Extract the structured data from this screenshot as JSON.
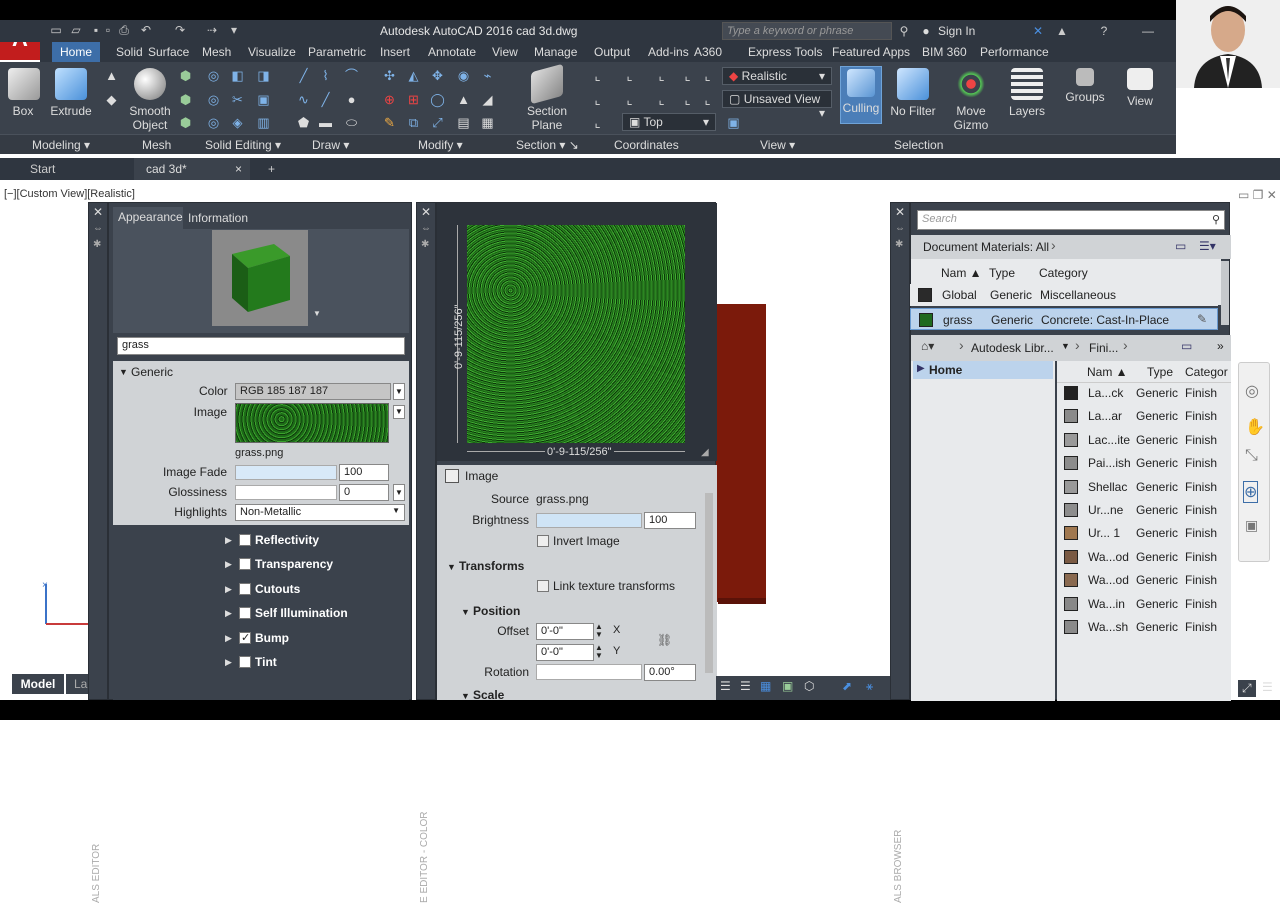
{
  "app": {
    "title": "Autodesk AutoCAD 2016    cad 3d.dwg",
    "search_placeholder": "Type a keyword or phrase",
    "signin": "Sign In",
    "logo": "A"
  },
  "menu_tabs": [
    "Home",
    "Solid",
    "Surface",
    "Mesh",
    "Visualize",
    "Parametric",
    "Insert",
    "Annotate",
    "View",
    "Manage",
    "Output",
    "Add-ins",
    "A360",
    "Express Tools",
    "Featured Apps",
    "BIM 360",
    "Performance"
  ],
  "ribbon": {
    "box": "Box",
    "extrude": "Extrude",
    "smooth_object": "Smooth Object",
    "section_plane": "Section Plane",
    "visual_style": "Realistic",
    "saved_view": "Unsaved View",
    "view_top": "Top",
    "culling": "Culling",
    "no_filter": "No Filter",
    "move_gizmo": "Move Gizmo",
    "layers": "Layers",
    "groups": "Groups",
    "view": "View",
    "panels": {
      "modeling": "Modeling",
      "mesh": "Mesh",
      "solid_editing": "Solid Editing",
      "draw": "Draw",
      "modify": "Modify",
      "section": "Section",
      "coordinates": "Coordinates",
      "view": "View",
      "selection": "Selection"
    }
  },
  "doc_tabs": {
    "start": "Start",
    "cad3d": "cad 3d*"
  },
  "viewport_label": "[−][Custom View][Realistic]",
  "model_tab": "Model",
  "layout_tab": "La",
  "material_editor": {
    "tab_appearance": "Appearance",
    "tab_information": "Information",
    "name": "grass",
    "generic": "Generic",
    "color_label": "Color",
    "color_value": "RGB 185 187 187",
    "image_label": "Image",
    "image_file": "grass.png",
    "image_fade_label": "Image Fade",
    "image_fade_value": "100",
    "glossiness_label": "Glossiness",
    "glossiness_value": "0",
    "highlights_label": "Highlights",
    "highlights_value": "Non-Metallic",
    "sections": [
      "Reflectivity",
      "Transparency",
      "Cutouts",
      "Self Illumination",
      "Bump",
      "Tint"
    ],
    "side_label": "ALS EDITOR"
  },
  "texture_editor": {
    "dim_vertical": "0'-9-115/256\"",
    "dim_horizontal": "0'-9-115/256\"",
    "image_header": "Image",
    "source_label": "Source",
    "source_value": "grass.png",
    "brightness_label": "Brightness",
    "brightness_value": "100",
    "invert_image": "Invert Image",
    "transforms": "Transforms",
    "link_texture": "Link texture transforms",
    "position": "Position",
    "offset_label": "Offset",
    "offset_x": "0'-0\"",
    "offset_y": "0'-0\"",
    "x": "X",
    "y": "Y",
    "rotation_label": "Rotation",
    "rotation_value": "0.00°",
    "scale": "Scale",
    "side_label": "E EDITOR - COLOR"
  },
  "materials_browser": {
    "search_placeholder": "Search",
    "doc_materials": "Document Materials: All",
    "col_name": "Nam",
    "col_type": "Type",
    "col_category": "Category",
    "doc_rows": [
      {
        "name": "Global",
        "type": "Generic",
        "category": "Miscellaneous",
        "color": "#2a2a2a"
      },
      {
        "name": "grass",
        "type": "Generic",
        "category": "Concrete: Cast-In-Place",
        "color": "#1f6a1f"
      }
    ],
    "lib_path1": "Autodesk Libr...",
    "lib_path2": "Fini...",
    "tree_home": "Home",
    "lib_col_name": "Nam",
    "lib_col_type": "Type",
    "lib_col_category": "Categor",
    "lib_rows": [
      {
        "name": "La...ck",
        "type": "Generic",
        "category": "Finish",
        "color": "#222222"
      },
      {
        "name": "La...ar",
        "type": "Generic",
        "category": "Finish",
        "color": "#8a8a8a"
      },
      {
        "name": "Lac...ite",
        "type": "Generic",
        "category": "Finish",
        "color": "#9a9a9a"
      },
      {
        "name": "Pai...ish",
        "type": "Generic",
        "category": "Finish",
        "color": "#8c8c8c"
      },
      {
        "name": "Shellac",
        "type": "Generic",
        "category": "Finish",
        "color": "#999999"
      },
      {
        "name": "Ur...ne",
        "type": "Generic",
        "category": "Finish",
        "color": "#8d8d8d"
      },
      {
        "name": "Ur... 1",
        "type": "Generic",
        "category": "Finish",
        "color": "#a07850"
      },
      {
        "name": "Wa...od",
        "type": "Generic",
        "category": "Finish",
        "color": "#7a5a44"
      },
      {
        "name": "Wa...od",
        "type": "Generic",
        "category": "Finish",
        "color": "#8a6a50"
      },
      {
        "name": "Wa...in",
        "type": "Generic",
        "category": "Finish",
        "color": "#888888"
      },
      {
        "name": "Wa...sh",
        "type": "Generic",
        "category": "Finish",
        "color": "#8a8a8a"
      }
    ],
    "side_label": "ALS BROWSER"
  },
  "colors": {
    "accent": "#3d6ea8",
    "panel": "#3b424c",
    "grass": "#2f8a22",
    "brick": "#7a1a0a"
  }
}
